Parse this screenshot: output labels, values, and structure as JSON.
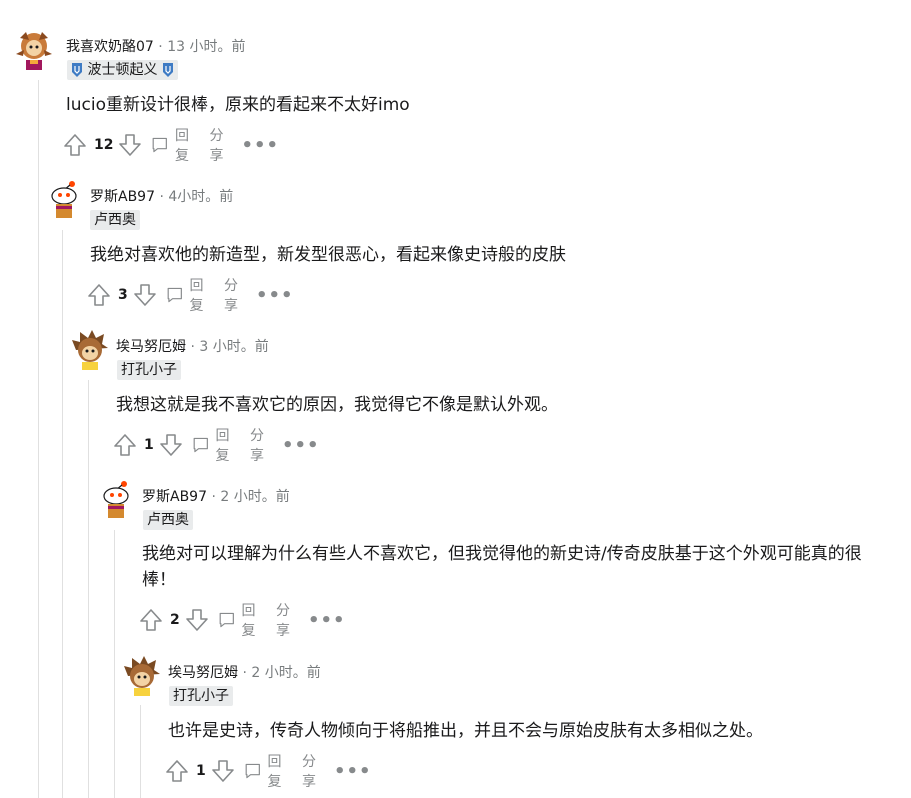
{
  "comments": [
    {
      "user": "我喜欢奶酪07",
      "sep": " · ",
      "time": "13 小时。前",
      "flair": "波士顿起义",
      "body": "lucio重新设计很棒，原来的看起来不太好imo",
      "votes": "12",
      "reply": "回复",
      "share": "分享",
      "more": "•••",
      "avatar": "lucio-avatar"
    },
    {
      "user": "罗斯AB97",
      "sep": " · ",
      "time": "4小时。前",
      "flair": "卢西奥",
      "body": "我绝对喜欢他的新造型，新发型很恶心，看起来像史诗般的皮肤",
      "votes": "3",
      "reply": "回复",
      "share": "分享",
      "more": "•••",
      "avatar": "snoo-avatar"
    },
    {
      "user": "埃马努厄姆",
      "sep": " · ",
      "time": "3 小时。前",
      "flair": "打孔小子",
      "body": "我想这就是我不喜欢它的原因，我觉得它不像是默认外观。",
      "votes": "1",
      "reply": "回复",
      "share": "分享",
      "more": "•••",
      "avatar": "hedgehog-avatar"
    },
    {
      "user": "罗斯AB97",
      "sep": " · ",
      "time": "2 小时。前",
      "flair": "卢西奥",
      "body": "我绝对可以理解为什么有些人不喜欢它，但我觉得他的新史诗/传奇皮肤基于这个外观可能真的很棒！",
      "votes": "2",
      "reply": "回复",
      "share": "分享",
      "more": "•••",
      "avatar": "snoo-avatar"
    },
    {
      "user": "埃马努厄姆",
      "sep": " · ",
      "time": "2 小时。前",
      "flair": "打孔小子",
      "body": "也许是史诗，传奇人物倾向于将船推出，并且不会与原始皮肤有太多相似之处。",
      "votes": "1",
      "reply": "回复",
      "share": "分享",
      "more": "•••",
      "avatar": "hedgehog-avatar"
    }
  ],
  "colors": {
    "accent": "#0079d3",
    "flair_bg": "#e9ebec",
    "meta": "#787c7e",
    "icon": "#878a8c",
    "shield": "#3e7bc4"
  }
}
